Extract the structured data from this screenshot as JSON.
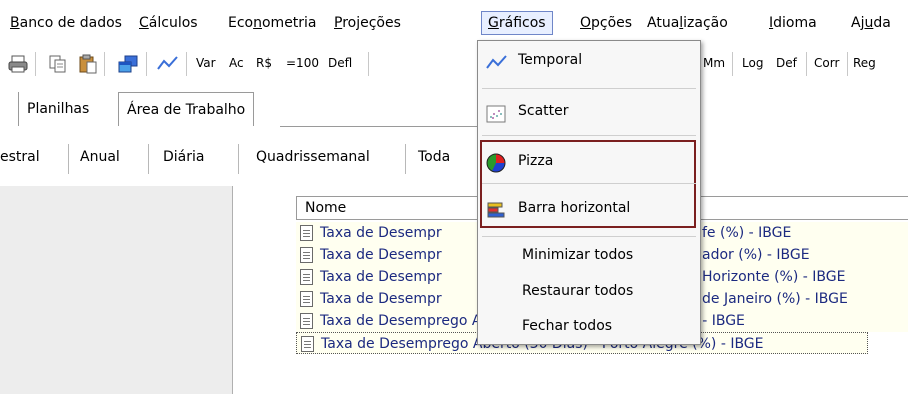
{
  "menubar": {
    "items": [
      {
        "pre": "",
        "mnem": "B",
        "post": "anco de dados"
      },
      {
        "pre": "",
        "mnem": "C",
        "post": "álculos"
      },
      {
        "pre": "Eco",
        "mnem": "n",
        "post": "ometria"
      },
      {
        "pre": "",
        "mnem": "P",
        "post": "rojeções"
      },
      {
        "pre": "",
        "mnem": "G",
        "post": "ráficos"
      },
      {
        "pre": "",
        "mnem": "O",
        "post": "pções"
      },
      {
        "pre": "Atua",
        "mnem": "l",
        "post": "ização"
      },
      {
        "pre": "",
        "mnem": "I",
        "post": "dioma"
      },
      {
        "pre": "Aj",
        "mnem": "u",
        "post": "da"
      }
    ],
    "active": "Gráficos"
  },
  "toolbar": {
    "icons": [
      "print-icon",
      "copy-icon",
      "paste-icon",
      "window-icon",
      "line-chart-icon"
    ],
    "buttons": [
      "Var",
      "Ac",
      "R$",
      "=100",
      "Defl"
    ],
    "right_buttons": [
      "Mm",
      "Log",
      "Def",
      "Corr",
      "Reg"
    ]
  },
  "tabs_main": {
    "items": [
      "Planilhas",
      "Área de Trabalho"
    ],
    "selected": "Área de Trabalho"
  },
  "tabs_freq": {
    "items": [
      "estral",
      "Anual",
      "Diária",
      "Quadrissemanal",
      "Toda"
    ]
  },
  "series": {
    "header": "Nome",
    "rows": [
      {
        "left": "Taxa de Desempr",
        "right": "fe (%) - IBGE"
      },
      {
        "left": "Taxa de Desempr",
        "right": "ador (%) - IBGE"
      },
      {
        "left": "Taxa de Desempr",
        "right": "Horizonte (%) - IBGE"
      },
      {
        "left": "Taxa de Desempr",
        "right": "de Janeiro (%) - IBGE"
      },
      {
        "left": "Taxa de Desemprego Aberto (30 Dias) - São Paulo (%) - IBGE",
        "right": ""
      },
      {
        "left": "Taxa de Desemprego Aberto (30 Dias) - Porto Alegre (%) - IBGE",
        "right": ""
      }
    ]
  },
  "dropdown": {
    "chart_items": [
      {
        "label": "Temporal",
        "icon": "line-chart-icon"
      },
      {
        "label": "Scatter",
        "icon": "scatter-icon"
      },
      {
        "label": "Pizza",
        "icon": "pie-chart-icon"
      },
      {
        "label": "Barra horizontal",
        "icon": "bar-chart-icon"
      }
    ],
    "window_items": [
      "Minimizar todos",
      "Restaurar todos",
      "Fechar todos"
    ]
  }
}
